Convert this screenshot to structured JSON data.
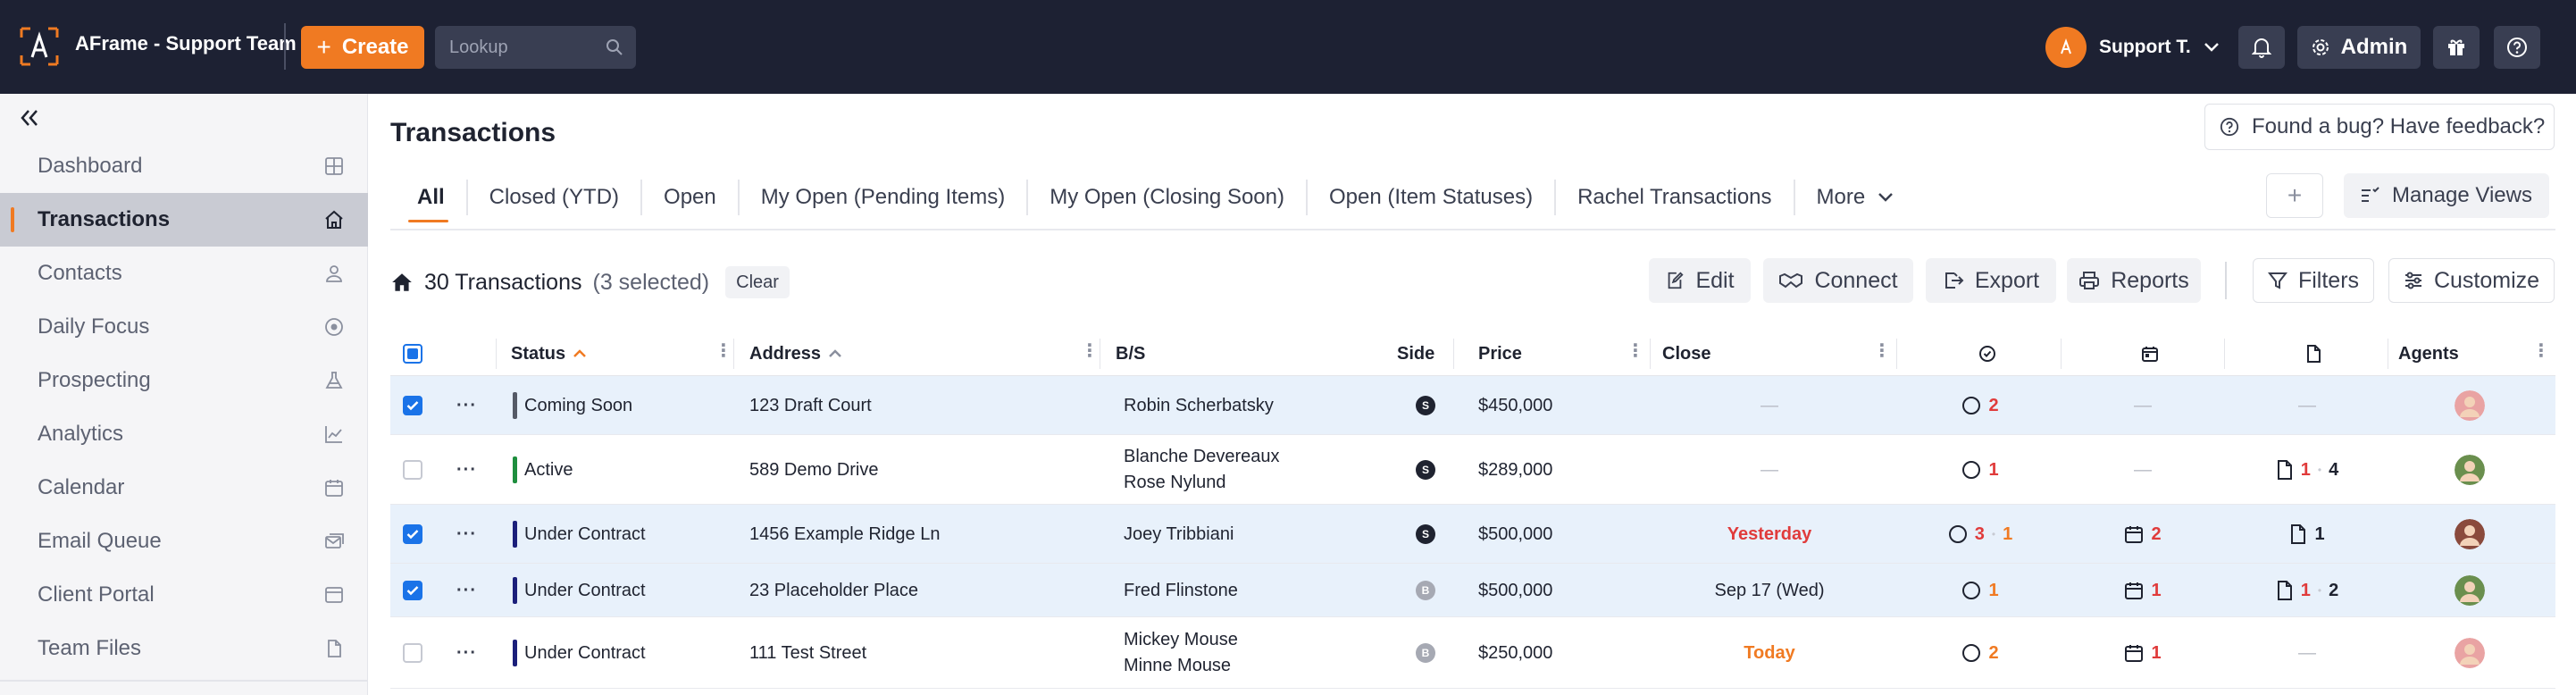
{
  "app": {
    "title": "AFrame - Support Team",
    "create_label": "Create",
    "lookup_placeholder": "Lookup",
    "user_name": "Support T.",
    "admin_label": "Admin"
  },
  "colors": {
    "accent": "#f07a22",
    "topbar": "#1d2133",
    "selected_row": "#e8f1fb",
    "checkbox": "#1a73e8"
  },
  "sidebar": {
    "items": [
      {
        "label": "Dashboard",
        "icon": "grid-icon"
      },
      {
        "label": "Transactions",
        "icon": "home-icon",
        "active": true
      },
      {
        "label": "Contacts",
        "icon": "person-icon"
      },
      {
        "label": "Daily Focus",
        "icon": "target-icon"
      },
      {
        "label": "Prospecting",
        "icon": "flask-icon"
      },
      {
        "label": "Analytics",
        "icon": "chart-icon"
      },
      {
        "label": "Calendar",
        "icon": "calendar-icon"
      },
      {
        "label": "Email Queue",
        "icon": "email-queue-icon"
      },
      {
        "label": "Client Portal",
        "icon": "browser-icon"
      },
      {
        "label": "Team Files",
        "icon": "file-icon"
      }
    ]
  },
  "page": {
    "title": "Transactions",
    "feedback_label": "Found a bug? Have feedback?"
  },
  "tabs": [
    {
      "label": "All",
      "active": true
    },
    {
      "label": "Closed (YTD)"
    },
    {
      "label": "Open"
    },
    {
      "label": "My Open (Pending Items)"
    },
    {
      "label": "My Open (Closing Soon)"
    },
    {
      "label": "Open (Item Statuses)"
    },
    {
      "label": "Rachel Transactions"
    },
    {
      "label": "More"
    }
  ],
  "manage_views_label": "Manage Views",
  "summary": {
    "count": "30 Transactions",
    "selected": "(3 selected)",
    "clear": "Clear"
  },
  "actions": {
    "edit": "Edit",
    "connect": "Connect",
    "export": "Export",
    "reports": "Reports",
    "filters": "Filters",
    "customize": "Customize"
  },
  "table": {
    "headers": {
      "status": "Status",
      "address": "Address",
      "bs": "B/S",
      "side": "Side",
      "price": "Price",
      "close": "Close",
      "agents": "Agents"
    },
    "rows": [
      {
        "selected": true,
        "status": "Coming Soon",
        "status_color": "#555a66",
        "address": "123 Draft Court",
        "bs": [
          "Robin Scherbatsky"
        ],
        "side": "S",
        "side_color": "#1f2330",
        "price": "$450,000",
        "close": "—",
        "close_color": "#b9bcc6",
        "tasks": {
          "a": "2",
          "a_color": "#e03b3b",
          "b": ""
        },
        "events": "",
        "docs": {
          "a": "",
          "b": ""
        },
        "agent_color": "#e9a3a3"
      },
      {
        "selected": false,
        "status": "Active",
        "status_color": "#1e8e3e",
        "address": "589 Demo Drive",
        "bs": [
          "Blanche Devereaux",
          "Rose Nylund"
        ],
        "side": "S",
        "side_color": "#1f2330",
        "price": "$289,000",
        "close": "—",
        "close_color": "#b9bcc6",
        "tasks": {
          "a": "1",
          "a_color": "#e03b3b",
          "b": ""
        },
        "events": "",
        "docs": {
          "a": "1",
          "b": "4"
        },
        "agent_color": "#6a8f4e"
      },
      {
        "selected": true,
        "status": "Under Contract",
        "status_color": "#1b1f7a",
        "address": "1456 Example Ridge Ln",
        "bs": [
          "Joey Tribbiani"
        ],
        "side": "S",
        "side_color": "#1f2330",
        "price": "$500,000",
        "close": "Yesterday",
        "close_color": "#e03b3b",
        "tasks": {
          "a": "3",
          "a_color": "#e03b3b",
          "b": "1"
        },
        "events": "2",
        "docs": {
          "a": "1",
          "b": ""
        },
        "agent_color": "#8a4a3c"
      },
      {
        "selected": true,
        "status": "Under Contract",
        "status_color": "#1b1f7a",
        "address": "23 Placeholder Place",
        "bs": [
          "Fred Flinstone"
        ],
        "side": "B",
        "side_color": "#a6a9b3",
        "price": "$500,000",
        "close": "Sep 17 (Wed)",
        "close_color": "#1f2330",
        "tasks": {
          "a": "1",
          "a_color": "#f07a22",
          "b": ""
        },
        "events": "1",
        "docs": {
          "a": "1",
          "b": "2"
        },
        "agent_color": "#6a8f4e"
      },
      {
        "selected": false,
        "status": "Under Contract",
        "status_color": "#1b1f7a",
        "address": "111 Test Street",
        "bs": [
          "Mickey Mouse",
          "Minne Mouse"
        ],
        "side": "B",
        "side_color": "#a6a9b3",
        "price": "$250,000",
        "close": "Today",
        "close_color": "#f07a22",
        "tasks": {
          "a": "2",
          "a_color": "#f07a22",
          "b": ""
        },
        "events": "1",
        "docs": {
          "a": "",
          "b": ""
        },
        "agent_color": "#e9a3a3"
      }
    ]
  }
}
